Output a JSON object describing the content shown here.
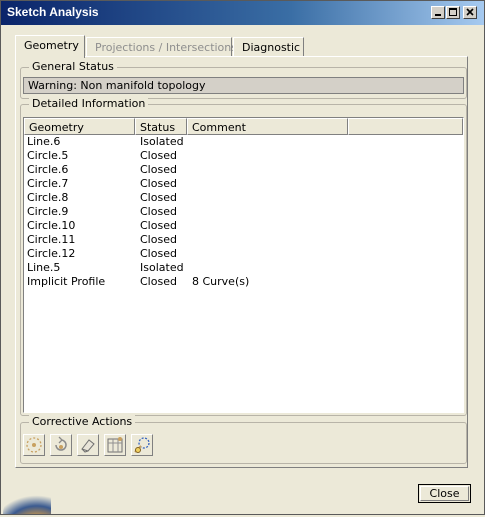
{
  "window": {
    "title": "Sketch Analysis"
  },
  "tabs": [
    {
      "label": "Geometry",
      "state": "active"
    },
    {
      "label": "Projections / Intersections",
      "state": "disabled"
    },
    {
      "label": "Diagnostic",
      "state": "normal"
    }
  ],
  "general_status": {
    "legend": "General Status",
    "message": "Warning: Non manifold topology"
  },
  "detailed_info": {
    "legend": "Detailed Information",
    "columns": [
      "Geometry",
      "Status",
      "Comment"
    ],
    "rows": [
      {
        "geometry": "Line.6",
        "status": "Isolated",
        "comment": ""
      },
      {
        "geometry": "Circle.5",
        "status": "Closed",
        "comment": ""
      },
      {
        "geometry": "Circle.6",
        "status": "Closed",
        "comment": ""
      },
      {
        "geometry": "Circle.7",
        "status": "Closed",
        "comment": ""
      },
      {
        "geometry": "Circle.8",
        "status": "Closed",
        "comment": ""
      },
      {
        "geometry": "Circle.9",
        "status": "Closed",
        "comment": ""
      },
      {
        "geometry": "Circle.10",
        "status": "Closed",
        "comment": ""
      },
      {
        "geometry": "Circle.11",
        "status": "Closed",
        "comment": ""
      },
      {
        "geometry": "Circle.12",
        "status": "Closed",
        "comment": ""
      },
      {
        "geometry": "Line.5",
        "status": "Isolated",
        "comment": ""
      },
      {
        "geometry": "Implicit Profile",
        "status": "Closed",
        "comment": "8 Curve(s)"
      }
    ]
  },
  "corrective_actions": {
    "legend": "Corrective Actions",
    "tools": [
      "dashed-circle-icon",
      "rotate-icon",
      "eraser-icon",
      "frame-grid-icon",
      "selection-profile-icon"
    ]
  },
  "buttons": {
    "close": "Close"
  },
  "colors": {
    "title_start": "#0a246a",
    "title_end": "#a6caf0",
    "face": "#ece9d8"
  }
}
